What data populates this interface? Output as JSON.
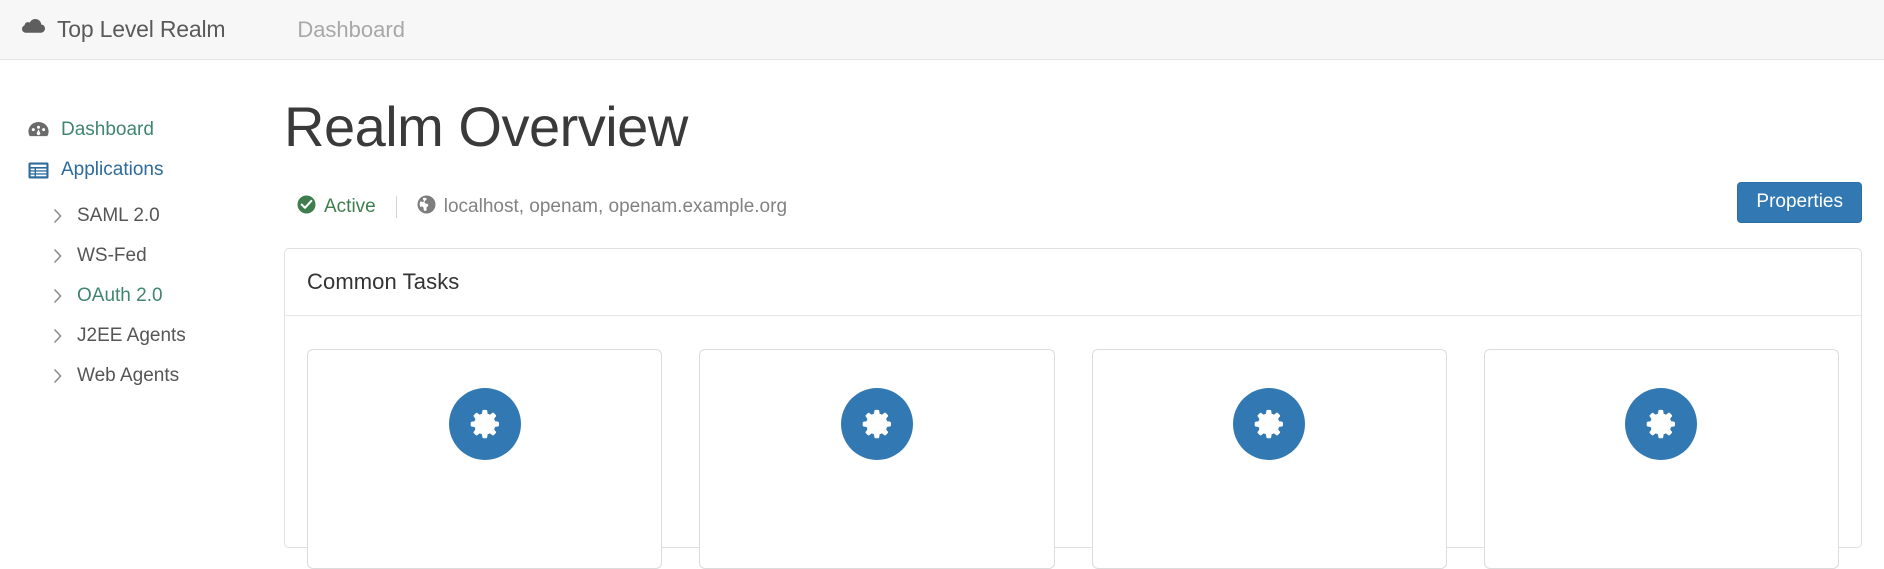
{
  "header": {
    "realm_icon": "cloud-icon",
    "realm_title": "Top Level Realm",
    "nav_link": "Dashboard"
  },
  "sidebar": {
    "items": [
      {
        "label": "Dashboard",
        "icon": "tachometer-icon",
        "color": "teal"
      },
      {
        "label": "Applications",
        "icon": "list-table-icon",
        "color": "blue"
      }
    ],
    "subitems": [
      {
        "label": "SAML 2.0",
        "icon": "chevron-right-icon",
        "active": false
      },
      {
        "label": "WS-Fed",
        "icon": "chevron-right-icon",
        "active": false
      },
      {
        "label": "OAuth 2.0",
        "icon": "chevron-right-icon",
        "active": true
      },
      {
        "label": "J2EE Agents",
        "icon": "chevron-right-icon",
        "active": false
      },
      {
        "label": "Web Agents",
        "icon": "chevron-right-icon",
        "active": false
      }
    ]
  },
  "main": {
    "page_title": "Realm Overview",
    "status": {
      "icon": "check-circle-icon",
      "label": "Active",
      "host_icon": "globe-icon",
      "hosts": "localhost, openam, openam.example.org"
    },
    "properties_button": "Properties",
    "panel": {
      "title": "Common Tasks",
      "cards": [
        {
          "icon": "gear-circle-icon"
        },
        {
          "icon": "gear-circle-icon"
        },
        {
          "icon": "gear-circle-icon"
        },
        {
          "icon": "gear-circle-icon"
        }
      ]
    }
  },
  "colors": {
    "accent_blue": "#3279b3",
    "link_blue": "#2c6b9c",
    "teal": "#40866f",
    "status_green": "#3f7d4e",
    "header_bg": "#f7f7f7"
  }
}
